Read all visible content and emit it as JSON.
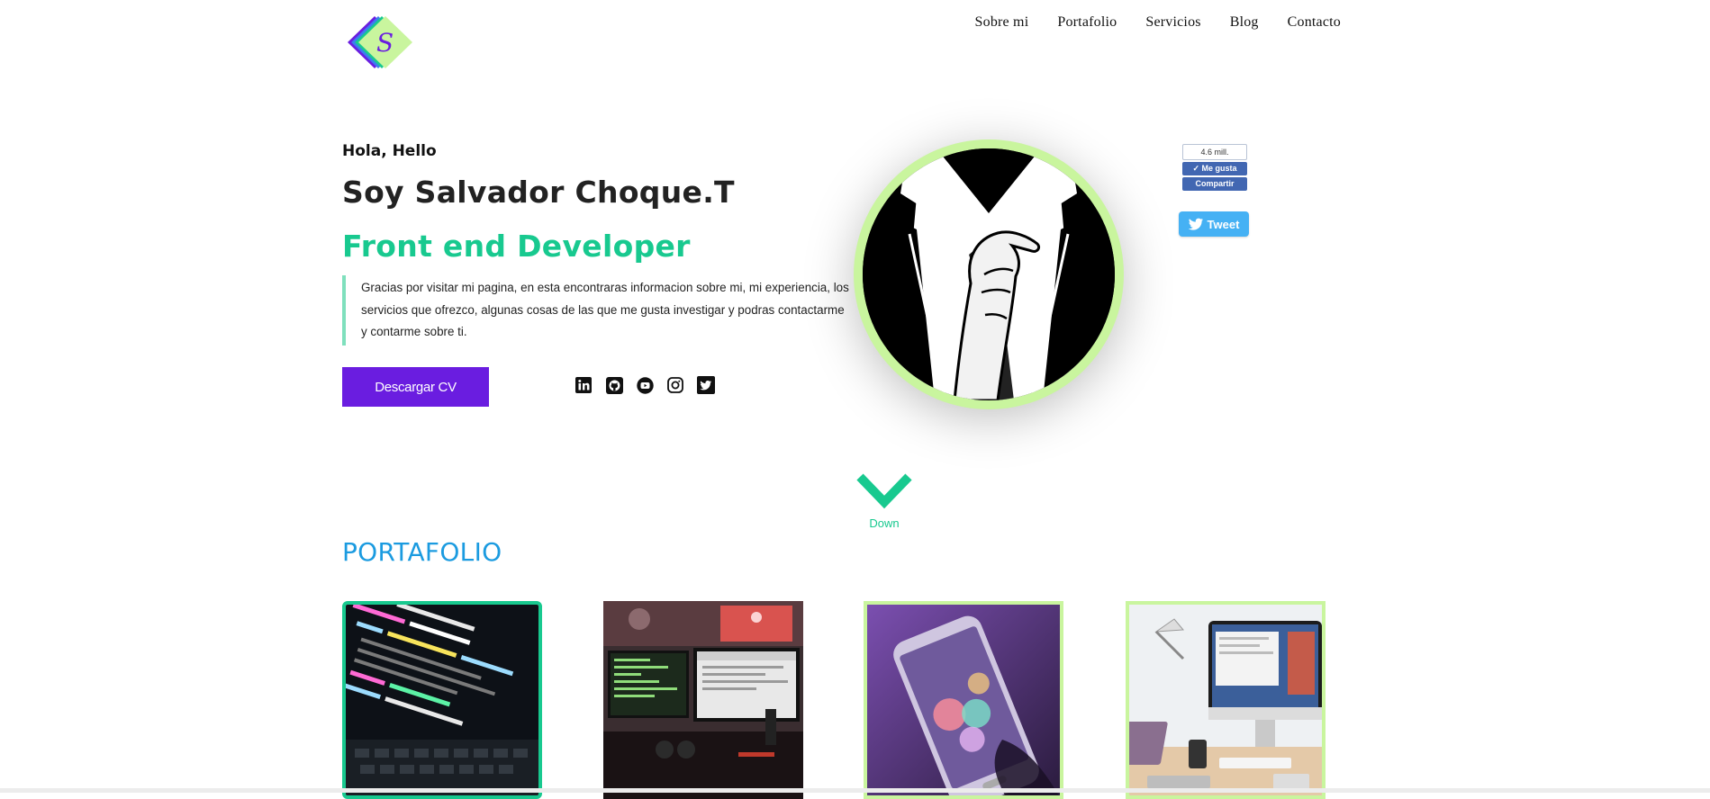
{
  "header": {
    "logo_icon": "stylized-s-diamond-logo",
    "nav": [
      "Sobre mi",
      "Portafolio",
      "Servicios",
      "Blog",
      "Contacto"
    ]
  },
  "hero": {
    "greeting": "Hola, Hello",
    "name": "Soy Salvador Choque.T",
    "role": "Front end Developer",
    "intro_lines": [
      "Gracias por visitar mi pagina, en esta encontraras informacion sobre mi, mi experiencia, los",
      "servicios que ofrezco, algunas cosas de las que me gusta investigar y podras contactarme",
      "y contarme sobre ti."
    ],
    "cv_button": "Descargar CV",
    "social_icons": [
      "linkedin-icon",
      "github-icon",
      "youtube-icon",
      "instagram-icon",
      "twitter-icon"
    ],
    "avatar_icon": "suit-and-tie-illustration"
  },
  "share": {
    "fb_count": "4.6 mill.",
    "fb_like": "Me gusta",
    "fb_share": "Compartir",
    "tweet": "Tweet"
  },
  "scroll": {
    "label": "Down",
    "icon": "chevron-down-icon"
  },
  "portfolio": {
    "title": "PORTAFOLIO",
    "cards": [
      {
        "image": "code-on-laptop-photo"
      },
      {
        "image": "dual-monitor-desk-photo"
      },
      {
        "image": "smartphone-bokeh-photo"
      },
      {
        "image": "imac-workspace-photo"
      }
    ]
  },
  "colors": {
    "accent_green": "#18c98f",
    "lime": "#c9f59e",
    "purple": "#6a1de0",
    "blue": "#1b9be0",
    "facebook": "#4267b2",
    "twitter": "#1da1f2"
  }
}
